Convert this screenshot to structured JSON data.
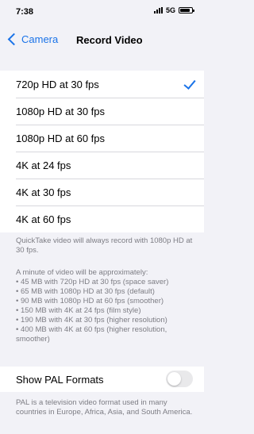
{
  "status": {
    "time": "7:38",
    "network": "5G"
  },
  "nav": {
    "back_label": "Camera",
    "title": "Record Video"
  },
  "options": [
    {
      "label": "720p HD at 30 fps"
    },
    {
      "label": "1080p HD at 30 fps"
    },
    {
      "label": "1080p HD at 60 fps"
    },
    {
      "label": "4K at 24 fps"
    },
    {
      "label": "4K at 30 fps"
    },
    {
      "label": "4K at 60 fps"
    }
  ],
  "selected_option": "720p HD at 30 fps",
  "footnote": {
    "quicktake": "QuickTake video will always record with 1080p HD at 30 fps.",
    "minute_intro": "A minute of video will be approximately:",
    "sizes": [
      "• 45 MB with 720p HD at 30 fps (space saver)",
      "• 65 MB with 1080p HD at 30 fps (default)",
      "• 90 MB with 1080p HD at 60 fps (smoother)",
      "• 150 MB with 4K at 24 fps (film style)",
      "• 190 MB with 4K at 30 fps (higher resolution)",
      "• 400 MB with 4K at 60 fps (higher resolution, smoother)"
    ]
  },
  "pal": {
    "label": "Show PAL Formats",
    "enabled": false,
    "description": "PAL is a television video format used in many countries in Europe, Africa, Asia, and South America."
  },
  "colors": {
    "accent": "#1a73e8",
    "highlight": "#f8b4e2",
    "background": "#f2f2f7",
    "footnote": "#7d7d84"
  }
}
